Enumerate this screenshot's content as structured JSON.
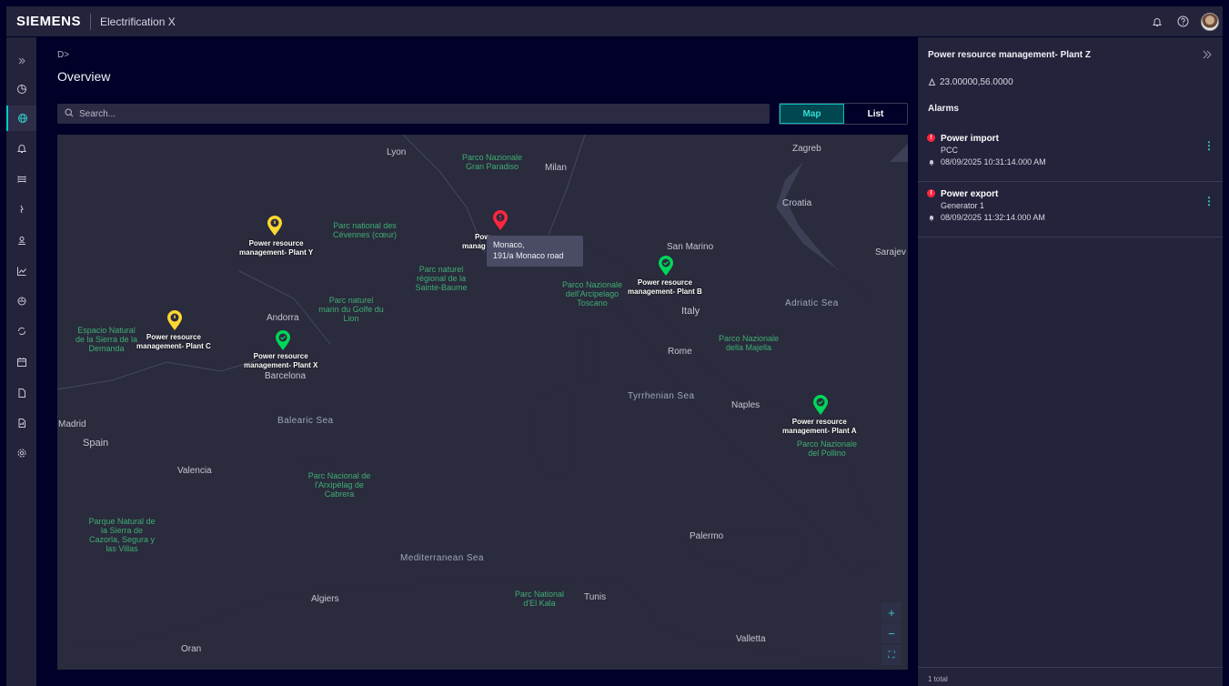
{
  "header": {
    "brand": "SIEMENS",
    "app_name": "Electrification X",
    "icons": [
      "bell-icon",
      "help-icon",
      "avatar"
    ]
  },
  "rail": {
    "items": [
      {
        "name": "expand-nav-icon"
      },
      {
        "name": "dashboard-icon"
      },
      {
        "name": "globe-icon",
        "active": true
      },
      {
        "name": "alarm-bell-icon"
      },
      {
        "name": "layers-icon"
      },
      {
        "name": "lightning-icon"
      },
      {
        "name": "user-location-icon"
      },
      {
        "name": "chart-icon"
      },
      {
        "name": "energy-cycle-icon"
      },
      {
        "name": "refresh-plug-icon"
      },
      {
        "name": "calendar-icon"
      },
      {
        "name": "document-icon"
      },
      {
        "name": "report-icon"
      },
      {
        "name": "settings-icon"
      }
    ]
  },
  "main": {
    "breadcrumb": "D>",
    "title": "Overview",
    "search_placeholder": "Search...",
    "view_toggle": {
      "map": "Map",
      "list": "List",
      "selected": "Map"
    }
  },
  "map": {
    "places": {
      "lyon": "Lyon",
      "milan": "Milan",
      "zagreb": "Zagreb",
      "croatia": "Croatia",
      "san_marino": "San Marino",
      "sarajevo": "Sarajev",
      "italy": "Italy",
      "rome": "Rome",
      "naples": "Naples",
      "andorra": "Andorra",
      "barcelona": "Barcelona",
      "madrid": "Madrid",
      "spain": "Spain",
      "valencia": "Valencia",
      "palermo": "Palermo",
      "algiers": "Algiers",
      "tunis": "Tunis",
      "valletta": "Valletta",
      "oran": "Oran"
    },
    "seas": {
      "adriatic": "Adriatic Sea",
      "tyrrhenian": "Tyrrhenian Sea",
      "balearic": "Balearic Sea",
      "mediterranean": "Mediterranean Sea"
    },
    "parks": {
      "gran_paradiso": "Parco Nazionale Gran Paradiso",
      "cevennes": "Parc national des Cévennes (cœur)",
      "sainte_baume": "Parc naturel régional de la Sainte-Baume",
      "golfe_lion": "Parc naturel marin du Golfe du Lion",
      "arcipelago": "Parco Nazionale dell'Arcipelago Toscano",
      "majella": "Parco Nazionale della Majella",
      "pollino": "Parco Nazionale del Pollino",
      "demanda": "Espacio Natural de la Sierra de la Demanda",
      "cabrera": "Parc Nacional de l'Arxipèlag de Cabrera",
      "cazorla": "Parque Natural de la Sierra de Cazorla, Segura y las Villas",
      "el_kala": "Parc National d'El Kala"
    },
    "plants": {
      "y": {
        "line1": "Power resource",
        "line2": "management- Plant Y",
        "status": "warning"
      },
      "c": {
        "line1": "Power resource",
        "line2": "management- Plant C",
        "status": "warning"
      },
      "x": {
        "line1": "Power resource",
        "line2": "management- Plant X",
        "status": "ok"
      },
      "b": {
        "line1": "Power resource",
        "line2": "management- Plant B",
        "status": "ok"
      },
      "a": {
        "line1": "Power resource",
        "line2": "management- Plant A",
        "status": "ok"
      },
      "z": {
        "line1": "Pow",
        "line2": "manag",
        "status": "alarm"
      }
    },
    "tooltip": {
      "line1": "Monaco,",
      "line2": "191/a Monaco road"
    },
    "zoom": {
      "in": "+",
      "out": "−",
      "fit": "⛶"
    },
    "colors": {
      "warning": "#ffd732",
      "ok": "#01d65a",
      "alarm": "#ff2640"
    }
  },
  "panel": {
    "title": "Power resource management- Plant Z",
    "coordinates": "23.00000,56.0000",
    "alarms_heading": "Alarms",
    "alarms": [
      {
        "title": "Power import",
        "source": "PCC",
        "time": "08/09/2025 10:31:14.000 AM"
      },
      {
        "title": "Power export",
        "source": "Generator 1",
        "time": "08/09/2025 11:32:14.000 AM"
      }
    ],
    "footer": "1 total",
    "alarm_more": "⋮",
    "alarm_badge": "!"
  }
}
